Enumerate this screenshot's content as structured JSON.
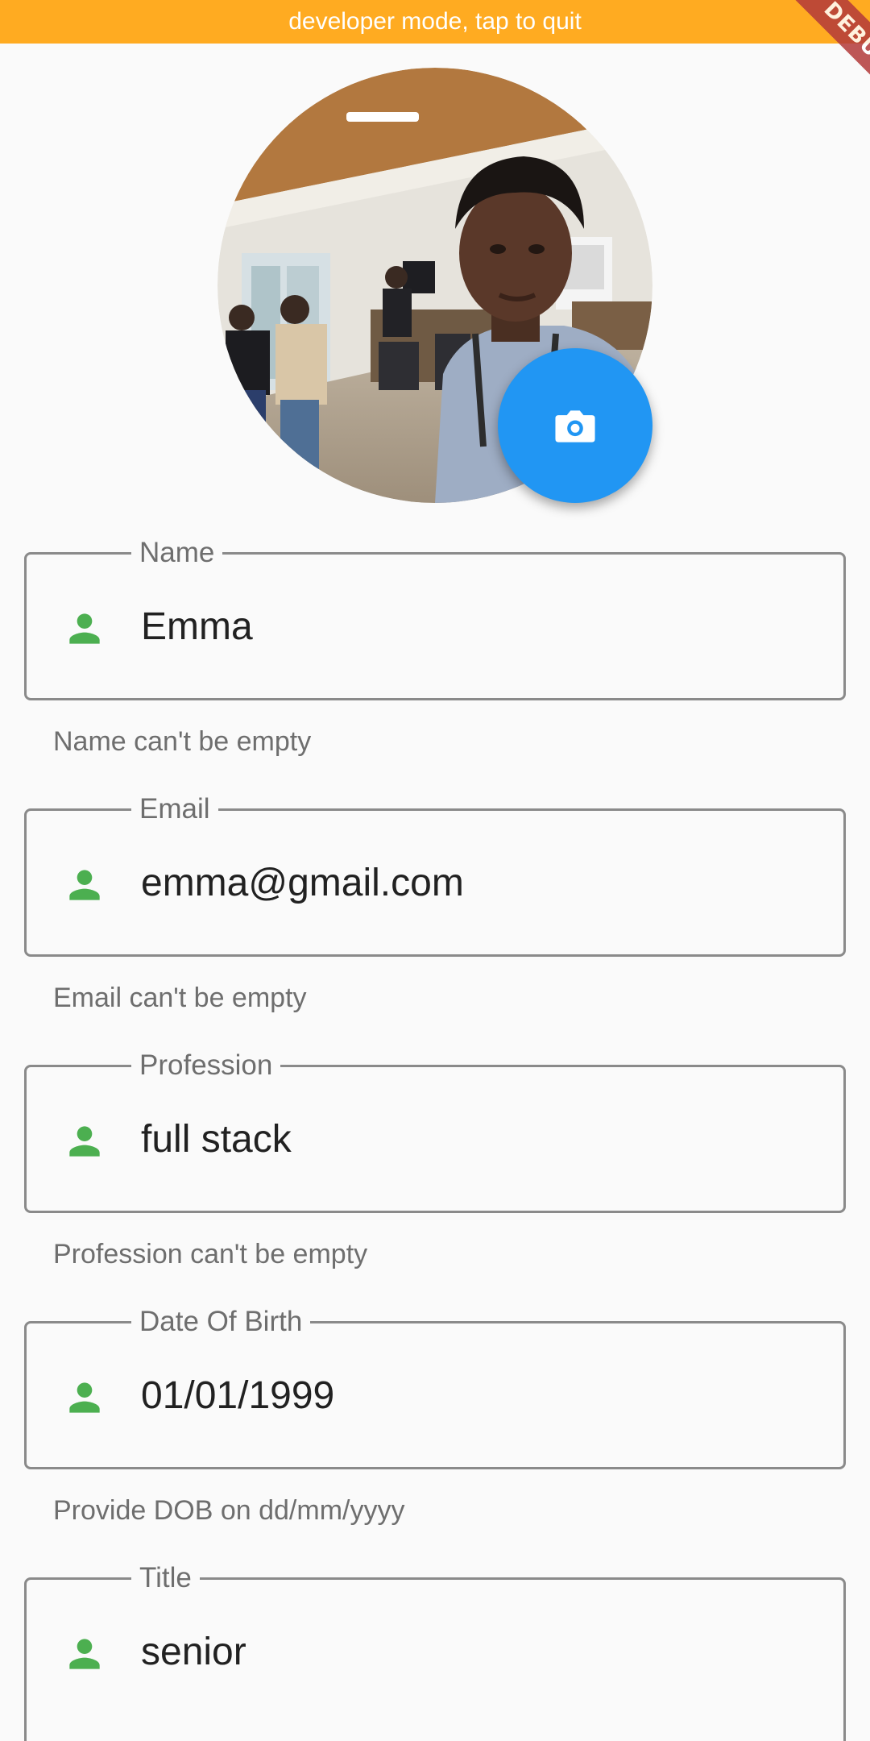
{
  "dev_banner": {
    "text": "developer mode, tap to quit"
  },
  "debug_ribbon": {
    "text": "DEBUG"
  },
  "profile": {
    "photo_icon": "profile-photo",
    "camera_icon": "camera-icon"
  },
  "fields": [
    {
      "label": "Name",
      "value": "Emma",
      "helper": "Name can't be empty",
      "icon": "person-icon"
    },
    {
      "label": "Email",
      "value": "emma@gmail.com",
      "helper": "Email can't be empty",
      "icon": "person-icon"
    },
    {
      "label": "Profession",
      "value": "full stack",
      "helper": "Profession can't be empty",
      "icon": "person-icon"
    },
    {
      "label": "Date Of Birth",
      "value": "01/01/1999",
      "helper": "Provide DOB on dd/mm/yyyy",
      "icon": "person-icon"
    },
    {
      "label": "Title",
      "value": "senior",
      "icon": "person-icon"
    }
  ],
  "colors": {
    "dev_banner": "#FFAB21",
    "accent": "#2196F3",
    "icon_green": "#4CAF50",
    "debug_ribbon": "#B33A3A"
  }
}
